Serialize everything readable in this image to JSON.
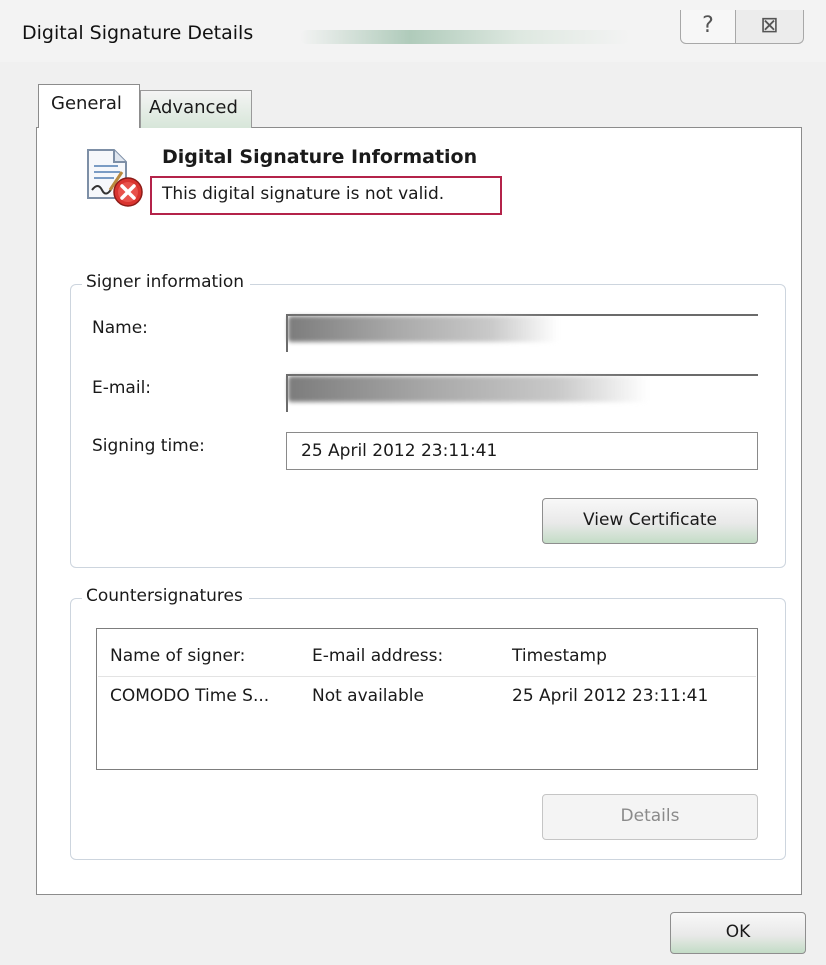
{
  "window": {
    "title": "Digital Signature Details"
  },
  "tabs": [
    {
      "label": "General",
      "active": true
    },
    {
      "label": "Advanced",
      "active": false
    }
  ],
  "signature": {
    "heading": "Digital Signature Information",
    "status": "This digital signature is not valid.",
    "status_highlight_color": "#b4234a"
  },
  "signer": {
    "group_label": "Signer information",
    "name_label": "Name:",
    "email_label": "E-mail:",
    "signing_time_label": "Signing time:",
    "signing_time_value": "25  April  2012 23:11:41",
    "view_certificate_label": "View Certificate"
  },
  "countersignatures": {
    "group_label": "Countersignatures",
    "columns": [
      "Name of signer:",
      "E-mail address:",
      "Timestamp"
    ],
    "rows": [
      [
        "COMODO Time S...",
        "Not available",
        "25 April 2012 23:11:41"
      ]
    ],
    "details_label": "Details"
  },
  "footer": {
    "ok_label": "OK"
  },
  "icons": {
    "help": "?",
    "close": "⊠"
  }
}
